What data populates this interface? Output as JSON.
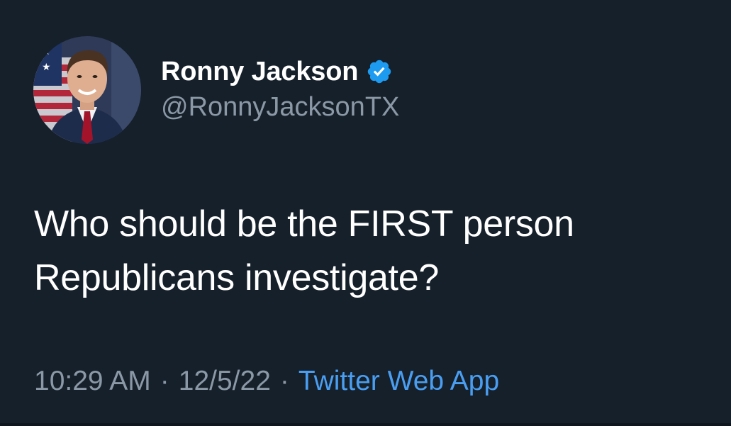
{
  "tweet": {
    "author": {
      "display_name": "Ronny Jackson",
      "handle": "@RonnyJacksonTX",
      "verified": true,
      "avatar_icon": "profile-photo"
    },
    "text_lines": [
      "Who should be the FIRST person",
      "Republicans investigate?"
    ],
    "meta": {
      "time": "10:29 AM",
      "separator": "·",
      "date": "12/5/22",
      "source": "Twitter Web App"
    }
  },
  "colors": {
    "background": "#16202b",
    "text_primary": "#ffffff",
    "text_secondary": "#8b98a5",
    "accent": "#4a9ef1",
    "verified_badge": "#1d9bf0"
  }
}
